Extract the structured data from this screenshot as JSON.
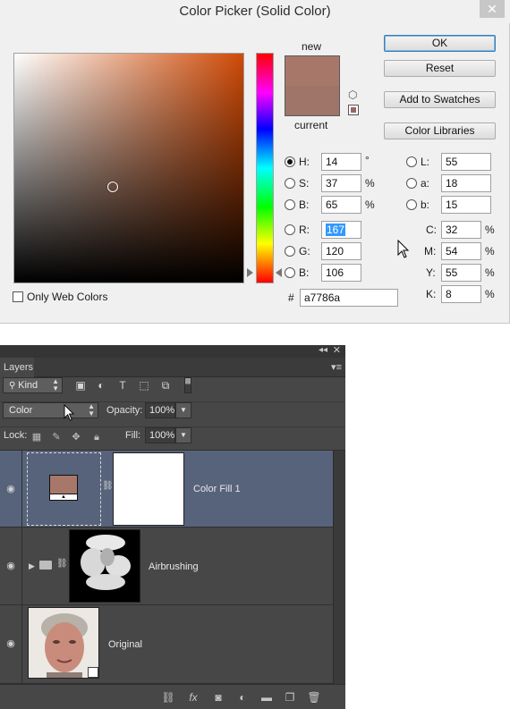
{
  "dialog": {
    "title": "Color Picker (Solid Color)",
    "close_glyph": "✕",
    "new_label": "new",
    "current_label": "current",
    "new_color": "#a7786a",
    "current_color": "#9e7568",
    "buttons": {
      "ok": "OK",
      "reset": "Reset",
      "add_to_swatches": "Add to Swatches",
      "color_libraries": "Color Libraries"
    },
    "hsb": {
      "h": {
        "label": "H:",
        "value": "14",
        "unit": "°"
      },
      "s": {
        "label": "S:",
        "value": "37",
        "unit": "%"
      },
      "b": {
        "label": "B:",
        "value": "65",
        "unit": "%"
      }
    },
    "rgb": {
      "r": {
        "label": "R:",
        "value": "167"
      },
      "g": {
        "label": "G:",
        "value": "120"
      },
      "b": {
        "label": "B:",
        "value": "106"
      }
    },
    "lab": {
      "l": {
        "label": "L:",
        "value": "55"
      },
      "a": {
        "label": "a:",
        "value": "18"
      },
      "b": {
        "label": "b:",
        "value": "15"
      }
    },
    "cmyk": {
      "c": {
        "label": "C:",
        "value": "32",
        "unit": "%"
      },
      "m": {
        "label": "M:",
        "value": "54",
        "unit": "%"
      },
      "y": {
        "label": "Y:",
        "value": "55",
        "unit": "%"
      },
      "k": {
        "label": "K:",
        "value": "8",
        "unit": "%"
      }
    },
    "hex_label": "#",
    "hex_value": "a7786a",
    "only_web_colors": "Only Web Colors"
  },
  "layers_panel": {
    "tab": "Layers",
    "filter_kind": "Kind",
    "blend_mode": "Color",
    "opacity_label": "Opacity:",
    "opacity_value": "100%",
    "lock_label": "Lock:",
    "fill_label": "Fill:",
    "fill_value": "100%",
    "layers": [
      {
        "name": "Color Fill 1",
        "selected": true
      },
      {
        "name": "Airbrushing",
        "selected": false
      },
      {
        "name": "Original",
        "selected": false
      }
    ],
    "fill_swatch_color": "#a7786a"
  }
}
